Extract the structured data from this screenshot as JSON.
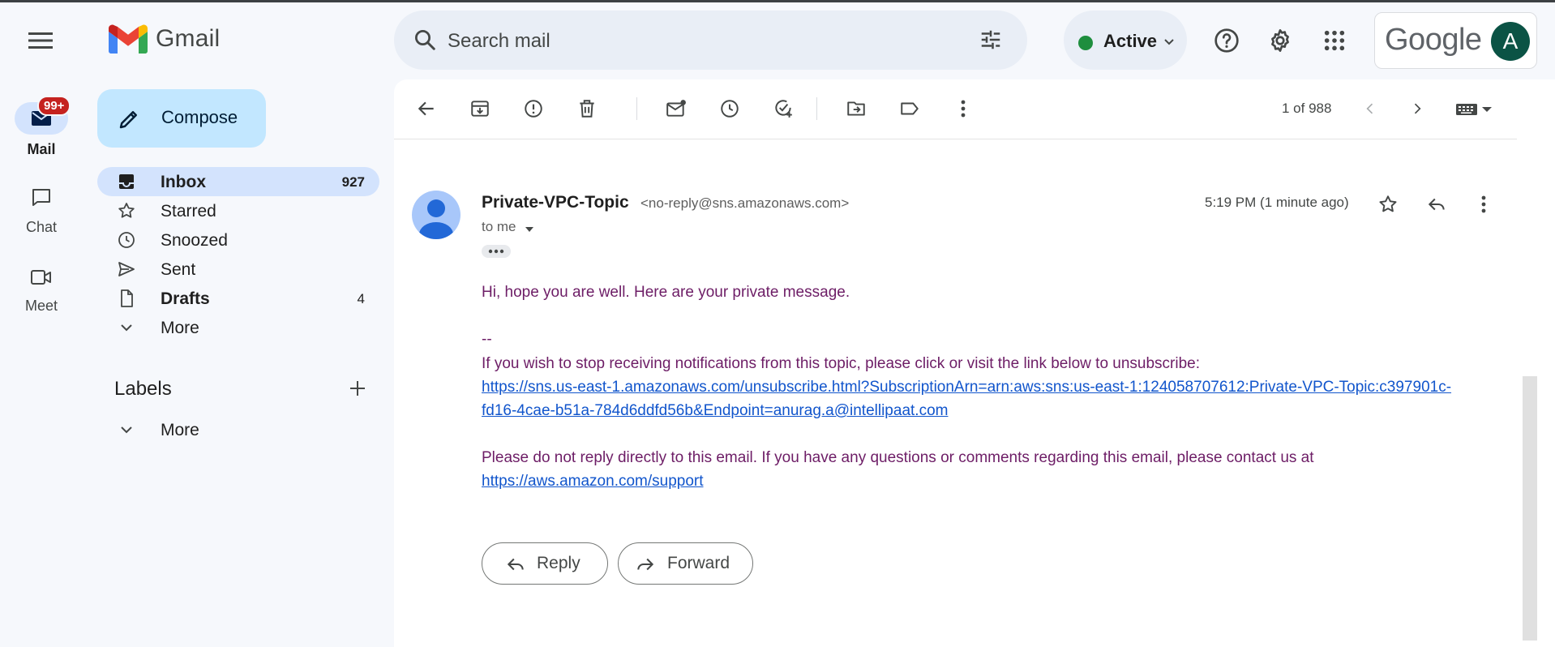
{
  "app": {
    "name": "Gmail"
  },
  "search": {
    "placeholder": "Search mail"
  },
  "status": {
    "label": "Active",
    "color": "#1e8e3e"
  },
  "account": {
    "brand": "Google",
    "avatar_letter": "A"
  },
  "rail": [
    {
      "label": "Mail",
      "badge": "99+",
      "icon": "mail-icon"
    },
    {
      "label": "Chat",
      "icon": "chat-icon"
    },
    {
      "label": "Meet",
      "icon": "meet-icon"
    }
  ],
  "compose": {
    "label": "Compose"
  },
  "nav": [
    {
      "label": "Inbox",
      "count": "927",
      "icon": "inbox-icon",
      "selected": true,
      "bold": true
    },
    {
      "label": "Starred",
      "count": "",
      "icon": "star-icon"
    },
    {
      "label": "Snoozed",
      "count": "",
      "icon": "clock-icon"
    },
    {
      "label": "Sent",
      "count": "",
      "icon": "send-icon"
    },
    {
      "label": "Drafts",
      "count": "4",
      "icon": "draft-icon",
      "bold": true
    },
    {
      "label": "More",
      "count": "",
      "icon": "chevron-down-icon"
    }
  ],
  "labels": {
    "title": "Labels",
    "more": "More"
  },
  "toolbar": {
    "pager": "1 of 988"
  },
  "message": {
    "sender_name": "Private-VPC-Topic",
    "sender_email": "<no-reply@sns.amazonaws.com>",
    "to": "to me",
    "time": "5:19 PM (1 minute ago)",
    "body": {
      "greeting": "Hi, hope you are well. Here are your private message.",
      "sig_sep": "--",
      "unsub_text": "If you wish to stop receiving notifications from this topic, please click or visit the link below to unsubscribe:",
      "unsub_link_1": "https://sns.us-east-1.amazonaws.com/unsubscribe.html?SubscriptionArn=arn:aws:sns:us-east-1:124058707612:Private-VPC-Topic:c397901c-",
      "unsub_link_2": "fd16-4cae-b51a-784d6ddfd56b&Endpoint=anurag.a@intellipaat.com",
      "noreply_text": "Please do not reply directly to this email. If you have any questions or comments regarding this email, please contact us at",
      "support_link": "https://aws.amazon.com/support"
    },
    "reply_label": "Reply",
    "forward_label": "Forward"
  },
  "colors": {
    "accent": "#0b57d0",
    "body_text": "#6d1d66",
    "link": "#1155cc",
    "avatar_bg": "#0b5345"
  }
}
